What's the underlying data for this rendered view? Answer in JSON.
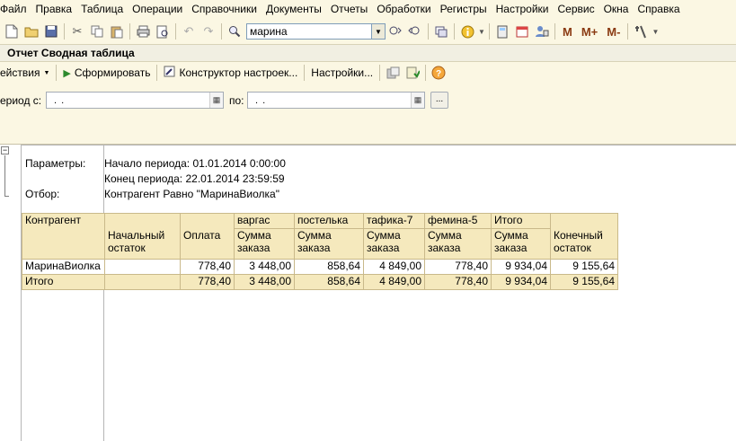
{
  "menu": {
    "items": [
      "Файл",
      "Правка",
      "Таблица",
      "Операции",
      "Справочники",
      "Документы",
      "Отчеты",
      "Обработки",
      "Регистры",
      "Настройки",
      "Сервис",
      "Окна",
      "Справка"
    ]
  },
  "toolbar": {
    "search_value": "марина",
    "m_label": "M",
    "m_plus_label": "M+",
    "m_minus_label": "M-"
  },
  "window": {
    "title": "Отчет  Сводная таблица"
  },
  "commandbar": {
    "actions_label": "ействия",
    "generate_label": "Сформировать",
    "constructor_label": "Конструктор настроек...",
    "settings_label": "Настройки...",
    "help_label": "?"
  },
  "period": {
    "from_label": "ериод с:",
    "from_value": ". .",
    "to_label": "по:",
    "to_value": ". .",
    "more_button": "..."
  },
  "report": {
    "params_label": "Параметры:",
    "params_start": "Начало периода: 01.01.2014 0:00:00",
    "params_end": "Конец периода: 22.01.2014 23:59:59",
    "filter_label": "Отбор:",
    "filter_value": "Контрагент Равно \"МаринаВиолка\"",
    "table": {
      "header1": [
        "Контрагент",
        "",
        "",
        "варгас",
        "постелька",
        "тафика-7",
        "фемина-5",
        "Итого",
        ""
      ],
      "header2": [
        "",
        "Начальный остаток",
        "Оплата",
        "Сумма заказа",
        "Сумма заказа",
        "Сумма заказа",
        "Сумма заказа",
        "Сумма заказа",
        "Конечный остаток"
      ],
      "data_row": [
        "МаринаВиолка",
        "",
        "778,40",
        "3 448,00",
        "858,64",
        "4 849,00",
        "778,40",
        "9 934,04",
        "9 155,64"
      ],
      "total_row": [
        "Итого",
        "",
        "778,40",
        "3 448,00",
        "858,64",
        "4 849,00",
        "778,40",
        "9 934,04",
        "9 155,64"
      ]
    }
  }
}
